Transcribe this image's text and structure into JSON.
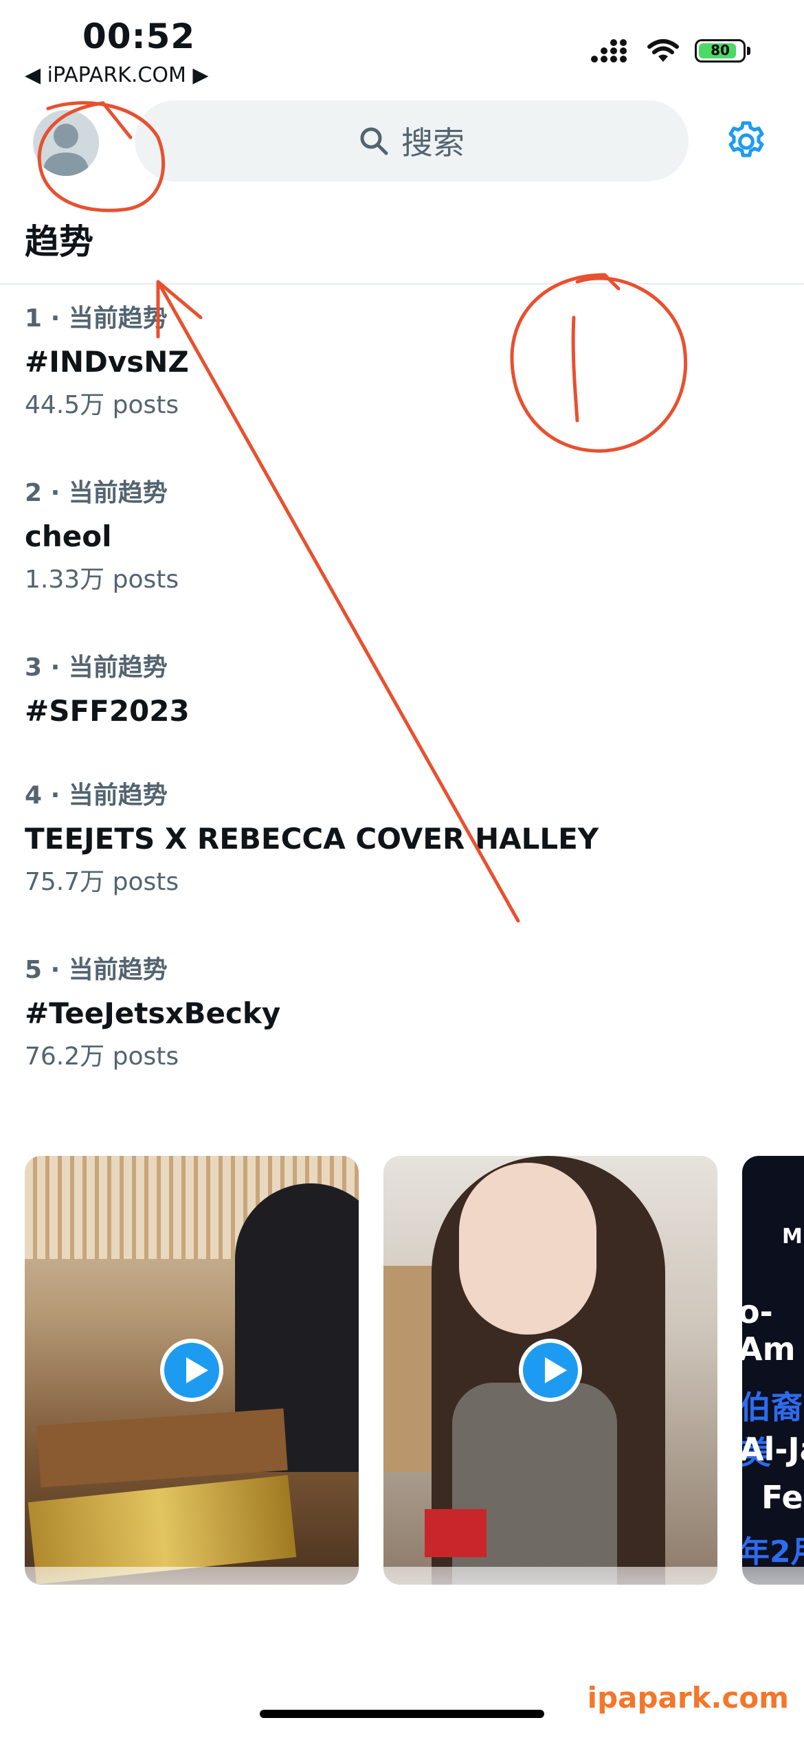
{
  "status_bar": {
    "time": "00:52",
    "back_app": "◀ iPAPARK.COM ▶",
    "battery": "80"
  },
  "header": {
    "search_label": "搜索",
    "title": "趋势"
  },
  "trends": [
    {
      "rank": "1 · 当前趋势",
      "name": "#INDvsNZ",
      "posts": "44.5万 posts"
    },
    {
      "rank": "2 · 当前趋势",
      "name": "cheol",
      "posts": "1.33万 posts"
    },
    {
      "rank": "3 · 当前趋势",
      "name": "#SFF2023",
      "posts": ""
    },
    {
      "rank": "4 · 当前趋势",
      "name": "TEEJETS X REBECCA COVER HALLEY",
      "posts": "75.7万 posts"
    },
    {
      "rank": "5 · 当前趋势",
      "name": "#TeeJetsxBecky",
      "posts": "76.2万 posts"
    }
  ],
  "cards": [
    {
      "icon": "play-icon"
    },
    {
      "icon": "play-icon"
    },
    {
      "lines": [
        "M",
        "o-Am",
        "伯裔美",
        "Al-Ja",
        "Fe",
        "年2月"
      ]
    }
  ],
  "annotation": {
    "note": "1"
  },
  "watermark": "ipapark.com",
  "colors": {
    "accent": "#1d9bf0",
    "secondary_text": "#536471",
    "annotation": "#e8502f",
    "watermark": "#f4762a"
  }
}
